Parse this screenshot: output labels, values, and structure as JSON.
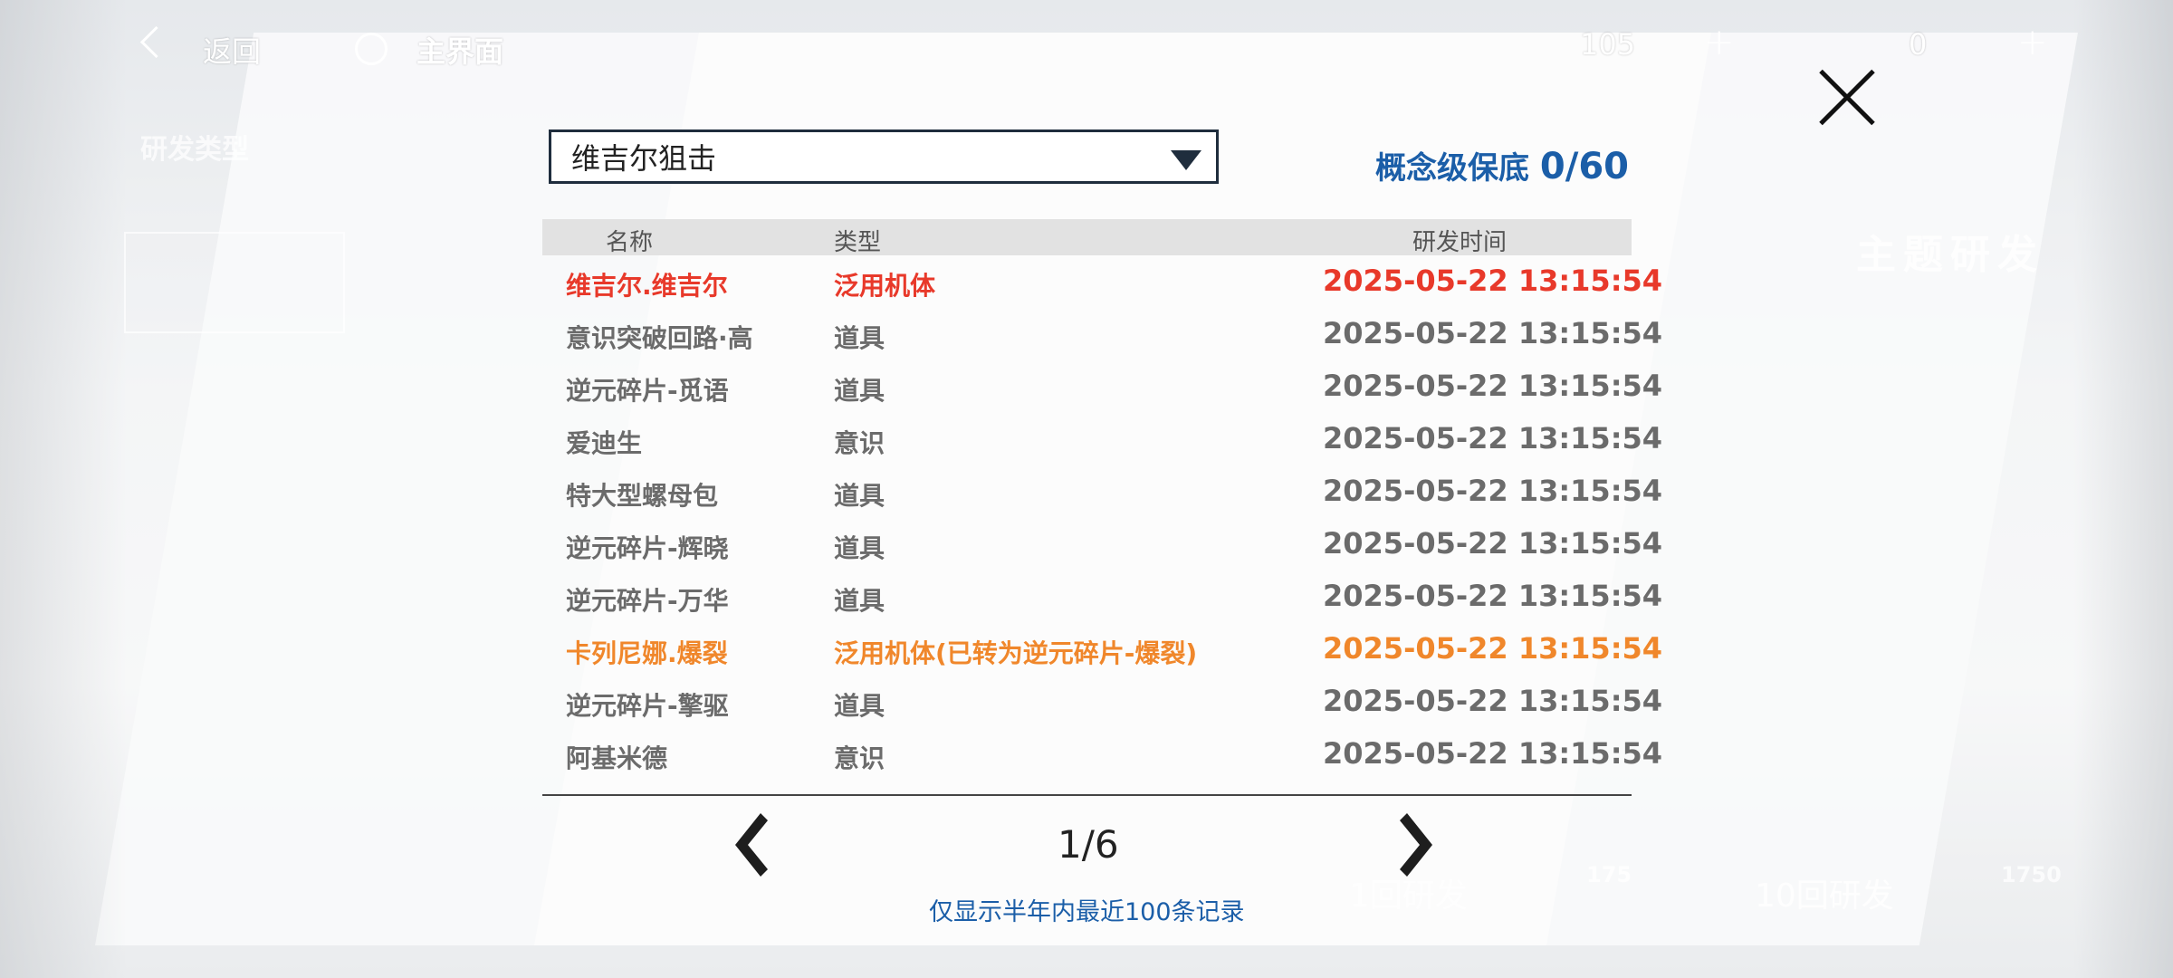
{
  "topbar": {
    "back_label": "返回",
    "home_label": "主界面",
    "currency1_value": "105",
    "currency2_value": "0",
    "plus": "+"
  },
  "dialog": {
    "dropdown_value": "维吉尔狙击",
    "guarantee_label": "概念级保底",
    "guarantee_value": "0/60",
    "columns": {
      "name": "名称",
      "type": "类型",
      "time": "研发时间"
    },
    "rows": [
      {
        "name": "维吉尔.维吉尔",
        "type": "泛用机体",
        "time": "2025-05-22 13:15:54",
        "color": "#e8392a"
      },
      {
        "name": "意识突破回路·高",
        "type": "道具",
        "time": "2025-05-22 13:15:54",
        "color": "#6b6b6b"
      },
      {
        "name": "逆元碎片-觅语",
        "type": "道具",
        "time": "2025-05-22 13:15:54",
        "color": "#6b6b6b"
      },
      {
        "name": "爱迪生",
        "type": "意识",
        "time": "2025-05-22 13:15:54",
        "color": "#6b6b6b"
      },
      {
        "name": "特大型螺母包",
        "type": "道具",
        "time": "2025-05-22 13:15:54",
        "color": "#6b6b6b"
      },
      {
        "name": "逆元碎片-辉晓",
        "type": "道具",
        "time": "2025-05-22 13:15:54",
        "color": "#6b6b6b"
      },
      {
        "name": "逆元碎片-万华",
        "type": "道具",
        "time": "2025-05-22 13:15:54",
        "color": "#6b6b6b"
      },
      {
        "name": "卡列尼娜.爆裂",
        "type": "泛用机体(已转为逆元碎片-爆裂)",
        "time": "2025-05-22 13:15:54",
        "color": "#f0872b"
      },
      {
        "name": "逆元碎片-擎驱",
        "type": "道具",
        "time": "2025-05-22 13:15:54",
        "color": "#6b6b6b"
      },
      {
        "name": "阿基米德",
        "type": "意识",
        "time": "2025-05-22 13:15:54",
        "color": "#6b6b6b"
      }
    ],
    "page": "1/6",
    "note": "仅显示半年内最近100条记录"
  },
  "background": {
    "research_type": "研发类型",
    "theme_research": "主题研发",
    "btn_1": "1回研发",
    "btn_10": "10回研发",
    "cost_1": "175",
    "cost_10": "1750"
  }
}
